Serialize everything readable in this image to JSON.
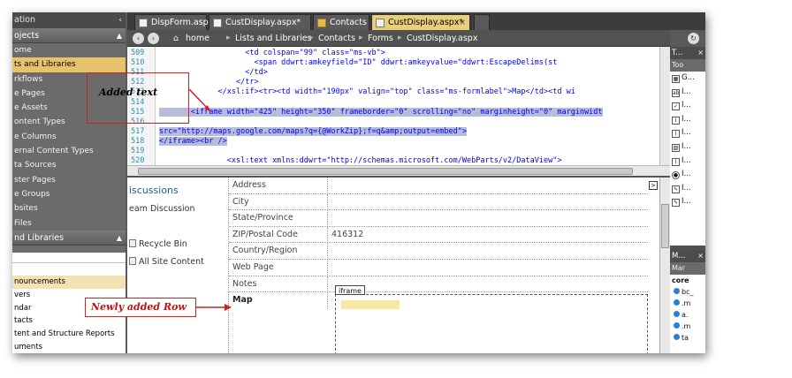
{
  "leftnav": {
    "header": "ation",
    "header_chevron": "‹",
    "sites_header": "ojects",
    "sites_items": [
      "ome",
      "ts and Libraries",
      "rkflows",
      "e Pages",
      "e Assets",
      "ontent Types",
      "e Columns",
      "ernal Content Types",
      "ta Sources",
      "ster Pages",
      "e Groups",
      "bsites",
      "Files"
    ],
    "selected_index": 1,
    "lists_header": "nd Libraries",
    "lists_items": [
      "nouncements",
      "vers",
      "ndar",
      "tacts",
      "tent and Structure Reports",
      "uments"
    ],
    "lists_selected_index": 0
  },
  "tabs": [
    {
      "label": "DispForm.aspx",
      "icon": "page-icon"
    },
    {
      "label": "CustDisplay.aspx*",
      "icon": "page-icon"
    },
    {
      "label": "Contacts",
      "icon": "list-folder-icon"
    },
    {
      "label": "CustDisplay.aspx*",
      "icon": "page-icon",
      "active": true
    }
  ],
  "tab_close": "×",
  "breadcrumb": {
    "back": "‹",
    "forward": "›",
    "items": [
      "home",
      "Lists and Libraries",
      "Contacts",
      "Forms",
      "CustDisplay.aspx"
    ],
    "sep": "▸",
    "refresh": "↻"
  },
  "code": {
    "lines": [
      {
        "n": "509",
        "indent": "                   ",
        "text": "<td colspan=\"99\" class=\"ms-vb\">"
      },
      {
        "n": "510",
        "indent": "                     ",
        "text": "<span ddwrt:amkeyfield=\"ID\" ddwrt:amkeyvalue=\"ddwrt:EscapeDelims(st"
      },
      {
        "n": "511",
        "indent": "                   ",
        "text": "</td>"
      },
      {
        "n": "512",
        "indent": "                 ",
        "text": "</tr>"
      },
      {
        "n": "513",
        "indent": "             ",
        "text": "</xsl:if><tr><td width=\"190px\" valign=\"top\" class=\"ms-formlabel\">Map</td><td wi"
      },
      {
        "n": "514",
        "indent": "",
        "text": ""
      },
      {
        "n": "515",
        "indent": "       ",
        "text": "<iframe width=\"425\" height=\"350\" frameborder=\"0\" scrolling=\"no\" marginheight=\"0\" marginwidt",
        "hl": true
      },
      {
        "n": "516",
        "indent": "",
        "text": "",
        "hl": true
      },
      {
        "n": "517",
        "indent": "",
        "text": "src=\"http://maps.google.com/maps?q={@WorkZip};f=q&amp;output=embed\">",
        "hl": true
      },
      {
        "n": "518",
        "indent": "",
        "text": "</iframe><br />",
        "hl": true
      },
      {
        "n": "519",
        "indent": "",
        "text": ""
      },
      {
        "n": "520",
        "indent": "               ",
        "text": "<xsl:text xmlns:ddwrt=\"http://schemas.microsoft.com/WebParts/v2/DataView\">"
      }
    ]
  },
  "design": {
    "left_links": [
      "iscussions",
      "eam Discussion",
      "Recycle Bin",
      "All Site Content"
    ],
    "fields": [
      {
        "label": "Address",
        "value": ""
      },
      {
        "label": "City",
        "value": ""
      },
      {
        "label": "State/Province",
        "value": ""
      },
      {
        "label": "ZIP/Postal Code",
        "value": "416312"
      },
      {
        "label": "Country/Region",
        "value": ""
      },
      {
        "label": "Web Page",
        "value": ""
      },
      {
        "label": "Notes",
        "value": ""
      },
      {
        "label": "Map",
        "value": ""
      }
    ],
    "iframe_tag": "iframe",
    "expand_glyph": ">"
  },
  "toolbox": {
    "header": "T...",
    "close": "×",
    "sub": "Too",
    "items": [
      {
        "label": "G...",
        "icon": "image-icon"
      },
      {
        "label": "I...",
        "icon": "label-icon"
      },
      {
        "label": "I...",
        "icon": "checkbox-icon"
      },
      {
        "label": "I...",
        "icon": "input-icon"
      },
      {
        "label": "I...",
        "icon": "input-icon"
      },
      {
        "label": "I...",
        "icon": "image-input-icon"
      },
      {
        "label": "I...",
        "icon": "input-icon"
      },
      {
        "label": "I...",
        "icon": "radio-icon"
      },
      {
        "label": "I...",
        "icon": "edit-icon"
      },
      {
        "label": "I...",
        "icon": "edit-icon"
      }
    ]
  },
  "manage": {
    "header": "M...",
    "close": "×",
    "sub": "Mar",
    "items": [
      "core",
      "bc_",
      ".m",
      "a.",
      ".m",
      "ta"
    ]
  },
  "annotations": {
    "added_text": "Added text",
    "new_row": "Newly added Row",
    "color": "#d21f1f"
  }
}
